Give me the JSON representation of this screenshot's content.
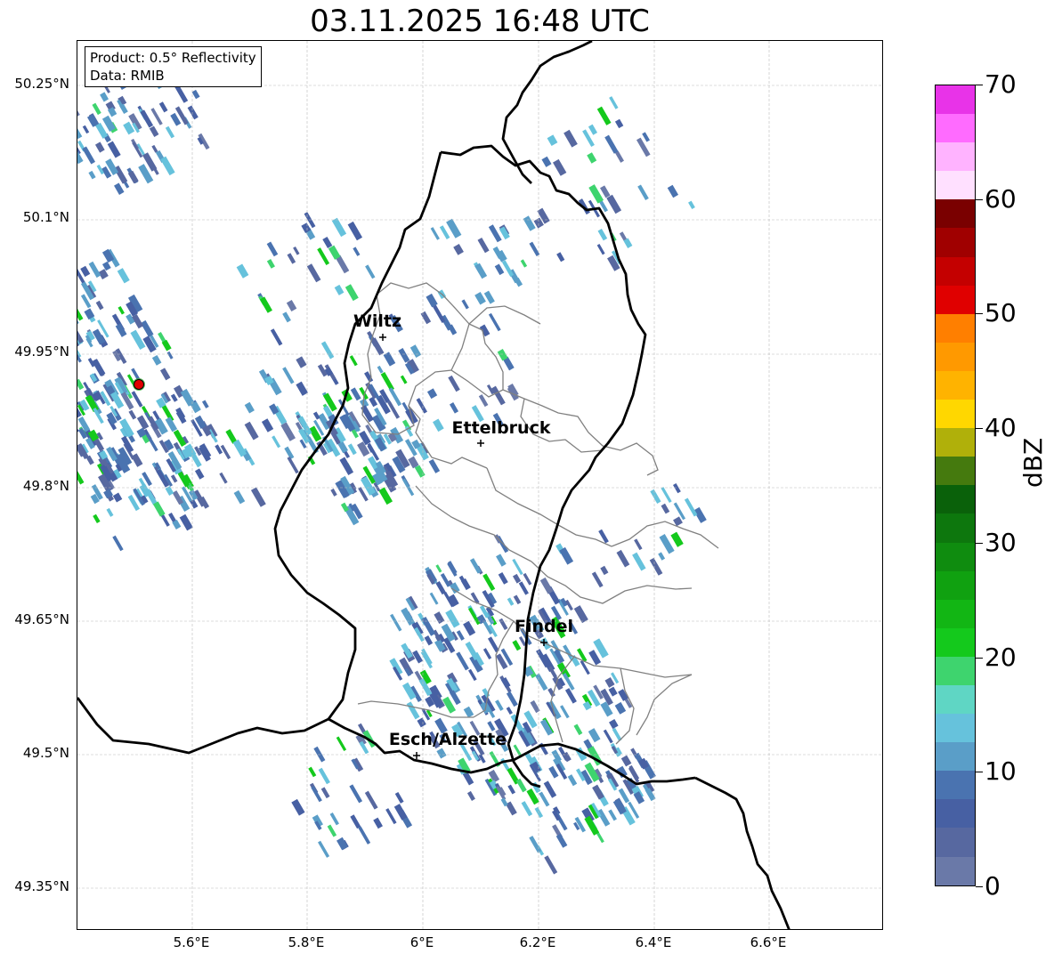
{
  "title": "03.11.2025 16:48 UTC",
  "info_box": {
    "product": "Product: 0.5° Reflectivity",
    "data": "Data: RMIB"
  },
  "lat_labels": [
    "50.25°N",
    "50.1°N",
    "49.95°N",
    "49.8°N",
    "49.65°N",
    "49.5°N",
    "49.35°N"
  ],
  "lon_labels": [
    "5.6°E",
    "5.8°E",
    "6°E",
    "6.2°E",
    "6.4°E",
    "6.6°E"
  ],
  "cities": [
    {
      "name": "Wiltz"
    },
    {
      "name": "Ettelbruck"
    },
    {
      "name": "Findel"
    },
    {
      "name": "Esch/Alzette"
    }
  ],
  "colorbar": {
    "label": "dBZ",
    "ticks": [
      "0",
      "10",
      "20",
      "30",
      "40",
      "50",
      "60",
      "70"
    ],
    "colors": [
      "#6a79a8",
      "#5768a0",
      "#4760a3",
      "#4a73b0",
      "#5a9ec8",
      "#66c2dc",
      "#5fd6c4",
      "#3ed46e",
      "#14c91c",
      "#12b614",
      "#10a110",
      "#0f8c0f",
      "#0d770d",
      "#0a610a",
      "#457a0e",
      "#b0b00a",
      "#ffd700",
      "#ffb300",
      "#ff9900",
      "#ff7f00",
      "#e00000",
      "#c40000",
      "#a00000",
      "#7a0000",
      "#ffe0ff",
      "#ffb3ff",
      "#ff6bff",
      "#e833e8"
    ]
  },
  "colors": {
    "border_black": "#000000",
    "canton_gray": "#808080",
    "grid": "#bbbbbb",
    "radar_site": "#e00000"
  }
}
